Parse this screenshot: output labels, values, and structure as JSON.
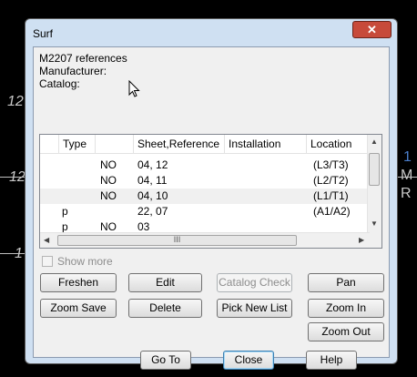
{
  "background": {
    "labels": [
      "12",
      "12",
      "1",
      "1",
      "M",
      "R"
    ]
  },
  "window": {
    "title": "Surf",
    "close_glyph": "✕"
  },
  "info": {
    "references": "M2207 references",
    "manufacturer": "Manufacturer:",
    "catalog": "Catalog:"
  },
  "grid": {
    "columns": [
      "",
      "Type",
      "",
      "Sheet,Reference",
      "Installation",
      "Location"
    ],
    "rows": [
      {
        "marker": "",
        "type": "",
        "flag": "NO",
        "sheet_ref": "04, 12",
        "installation": "",
        "location": "(L3/T3)"
      },
      {
        "marker": "",
        "type": "",
        "flag": "NO",
        "sheet_ref": "04, 11",
        "installation": "",
        "location": "(L2/T2)"
      },
      {
        "marker": "",
        "type": "",
        "flag": "NO",
        "sheet_ref": "04, 10",
        "installation": "",
        "location": "(L1/T1)"
      },
      {
        "marker": "",
        "type": "p",
        "flag": "",
        "sheet_ref": "22, 07",
        "installation": "",
        "location": "(A1/A2)"
      },
      {
        "marker": "",
        "type": "p",
        "flag": "NO",
        "sheet_ref": "03",
        "installation": "",
        "location": ""
      }
    ],
    "hthumb_grip": "III"
  },
  "show_more": {
    "label": "Show more",
    "checked": false,
    "enabled": false
  },
  "buttons": {
    "freshen": "Freshen",
    "edit": "Edit",
    "catalog_check": "Catalog Check",
    "pan": "Pan",
    "zoom_save": "Zoom Save",
    "delete": "Delete",
    "pick_new_list": "Pick New List",
    "zoom_in": "Zoom In",
    "zoom_out": "Zoom Out",
    "go_to": "Go To",
    "close": "Close",
    "help": "Help"
  }
}
